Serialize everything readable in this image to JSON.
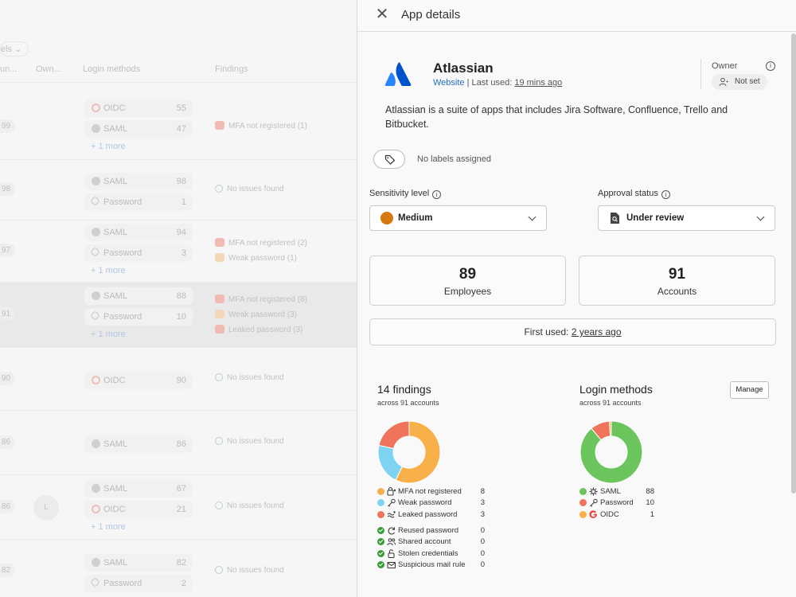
{
  "background_table": {
    "filter_label": "els",
    "columns": [
      "un...",
      "Own...",
      "Login methods",
      "Findings"
    ],
    "rows": [
      {
        "count": "99",
        "logins": [
          {
            "icon": "google-icon",
            "name": "OIDC",
            "count": "55"
          },
          {
            "icon": "saml-icon",
            "name": "SAML",
            "count": "47"
          }
        ],
        "more": "+ 1 more",
        "findings": [
          {
            "type": "red",
            "text": "MFA not registered (1)"
          }
        ]
      },
      {
        "count": "98",
        "logins": [
          {
            "icon": "saml-icon",
            "name": "SAML",
            "count": "98"
          },
          {
            "icon": "key-icon",
            "name": "Password",
            "count": "1"
          }
        ],
        "more": "",
        "findings": [
          {
            "type": "ok",
            "text": "No issues found"
          }
        ]
      },
      {
        "count": "97",
        "logins": [
          {
            "icon": "saml-icon",
            "name": "SAML",
            "count": "94"
          },
          {
            "icon": "key-icon",
            "name": "Password",
            "count": "3"
          }
        ],
        "more": "+ 1 more",
        "findings": [
          {
            "type": "red",
            "text": "MFA not registered (2)"
          },
          {
            "type": "org",
            "text": "Weak password (1)"
          }
        ]
      },
      {
        "count": "91",
        "logins": [
          {
            "icon": "saml-icon",
            "name": "SAML",
            "count": "88"
          },
          {
            "icon": "key-icon",
            "name": "Password",
            "count": "10"
          }
        ],
        "more": "+ 1 more",
        "findings": [
          {
            "type": "red",
            "text": "MFA not registered (8)"
          },
          {
            "type": "org",
            "text": "Weak password (3)"
          },
          {
            "type": "red",
            "text": "Leaked password (3)"
          }
        ]
      },
      {
        "count": "90",
        "logins": [
          {
            "icon": "google-icon",
            "name": "OIDC",
            "count": "90"
          }
        ],
        "more": "",
        "findings": [
          {
            "type": "ok",
            "text": "No issues found"
          }
        ]
      },
      {
        "count": "86",
        "logins": [
          {
            "icon": "saml-icon",
            "name": "SAML",
            "count": "86"
          }
        ],
        "more": "",
        "findings": [
          {
            "type": "ok",
            "text": "No issues found"
          }
        ]
      },
      {
        "count": "86",
        "avatar": "L",
        "logins": [
          {
            "icon": "saml-icon",
            "name": "SAML",
            "count": "67"
          },
          {
            "icon": "google-icon",
            "name": "OIDC",
            "count": "21"
          }
        ],
        "more": "+ 1 more",
        "findings": [
          {
            "type": "ok",
            "text": "No issues found"
          }
        ]
      },
      {
        "count": "82",
        "logins": [
          {
            "icon": "saml-icon",
            "name": "SAML",
            "count": "82"
          },
          {
            "icon": "key-icon",
            "name": "Password",
            "count": "2"
          }
        ],
        "more": "",
        "findings": [
          {
            "type": "ok",
            "text": "No issues found"
          }
        ]
      }
    ]
  },
  "panel": {
    "title": "App details",
    "app": {
      "name": "Atlassian",
      "website_label": "Website",
      "last_used_prefix": "| Last used:",
      "last_used_value": "19 mins ago",
      "description": "Atlassian is a suite of apps that includes Jira Software, Confluence, Trello and Bitbucket.",
      "brand_color": "#2684ff"
    },
    "owner": {
      "label": "Owner",
      "value": "Not set"
    },
    "labels": {
      "empty_text": "No labels assigned"
    },
    "sensitivity": {
      "label": "Sensitivity level",
      "value": "Medium",
      "color": "#d4780f"
    },
    "approval": {
      "label": "Approval status",
      "value": "Under review"
    },
    "stats": {
      "employees": {
        "value": "89",
        "label": "Employees"
      },
      "accounts": {
        "value": "91",
        "label": "Accounts"
      }
    },
    "first_used": {
      "prefix": "First used:",
      "value": "2 years ago"
    },
    "findings": {
      "title": "14 findings",
      "subtitle": "across 91 accounts",
      "items": [
        {
          "name": "MFA not registered",
          "count": 8,
          "color": "#f8b04b",
          "icon": "mfa-icon"
        },
        {
          "name": "Weak password",
          "count": 3,
          "color": "#7fd3f2",
          "icon": "key-icon"
        },
        {
          "name": "Leaked password",
          "count": 3,
          "color": "#f0735c",
          "icon": "leak-icon"
        }
      ],
      "ok_items": [
        {
          "name": "Reused password",
          "count": 0,
          "icon": "refresh-icon"
        },
        {
          "name": "Shared account",
          "count": 0,
          "icon": "users-icon"
        },
        {
          "name": "Stolen credentials",
          "count": 0,
          "icon": "unlock-icon"
        },
        {
          "name": "Suspicious mail rule",
          "count": 0,
          "icon": "mail-icon"
        }
      ]
    },
    "login_methods": {
      "title": "Login methods",
      "subtitle": "across 91 accounts",
      "manage_label": "Manage",
      "items": [
        {
          "name": "SAML",
          "count": 88,
          "color": "#6cc45c",
          "icon": "saml-icon"
        },
        {
          "name": "Password",
          "count": 10,
          "color": "#f0735c",
          "icon": "key-icon"
        },
        {
          "name": "OIDC",
          "count": 1,
          "color": "#f8b04b",
          "icon": "google-icon"
        }
      ]
    },
    "ok_color": "#3a9b3a"
  }
}
